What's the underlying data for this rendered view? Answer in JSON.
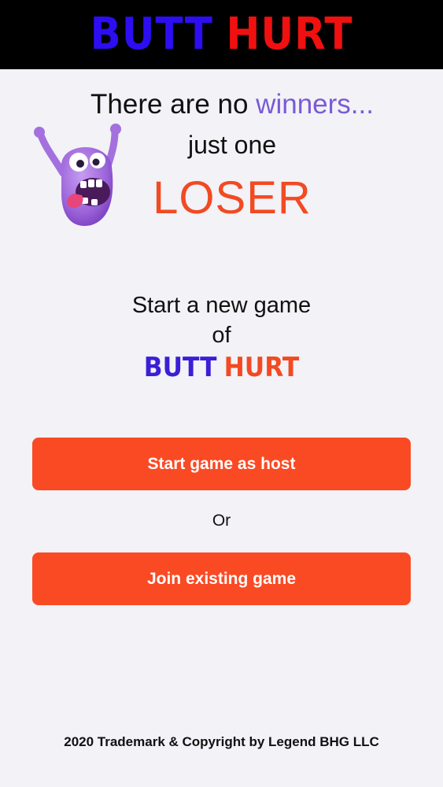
{
  "colors": {
    "header_bg": "#000000",
    "logo_blue": "#2d0df2",
    "logo_red": "#f01010",
    "logo_blue_small": "#3a1fd6",
    "accent_orange": "#f24a22",
    "accent_purple": "#7a5ad6",
    "button_bg": "#fa4a24",
    "page_bg": "#f2f2f7"
  },
  "header": {
    "logo_word1": "BUTT",
    "logo_word2": "HURT"
  },
  "tagline": {
    "line1_prefix": "There are no ",
    "line1_highlight": "winners...",
    "line2": "just one",
    "line3": "LOSER"
  },
  "illustration": {
    "icon": "purple-monster-icon"
  },
  "start": {
    "line1": "Start a new game",
    "line2": "of",
    "logo_word1": "BUTT",
    "logo_word2": "HURT"
  },
  "buttons": {
    "host_label": "Start game as host",
    "or_label": "Or",
    "join_label": "Join existing game"
  },
  "footer": {
    "text": "2020 Trademark & Copyright by Legend BHG LLC"
  }
}
